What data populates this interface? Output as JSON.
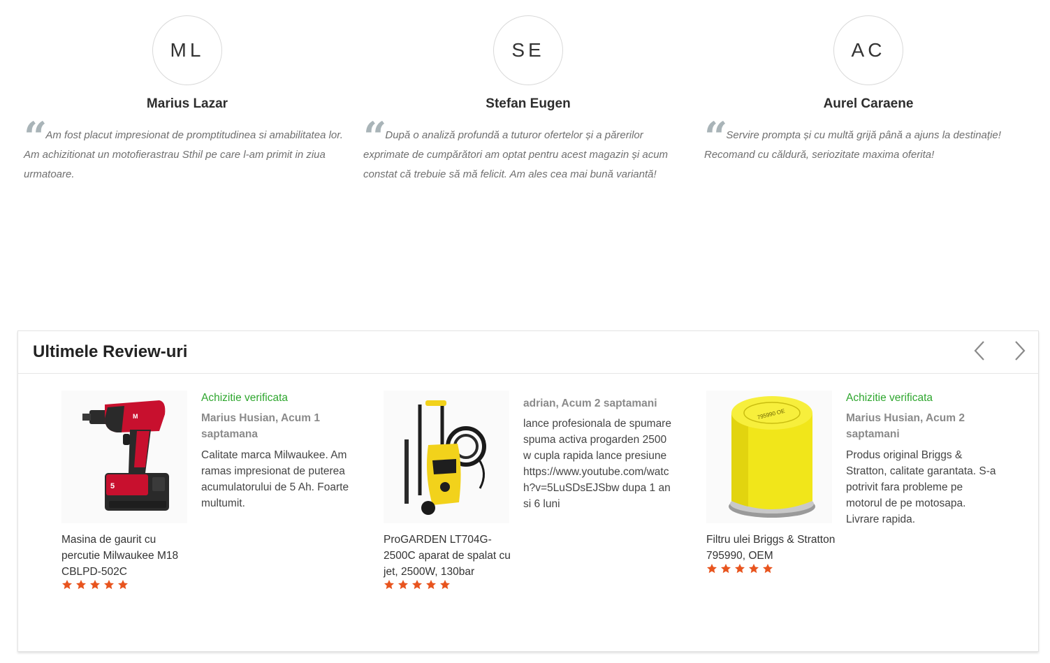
{
  "testimonials": [
    {
      "initials": "ML",
      "name": "Marius Lazar",
      "text": "Am fost placut impresionat de promptitudinea si amabilitatea lor. Am achizitionat un motofierastrau Sthil pe care l-am primit in ziua urmatoare."
    },
    {
      "initials": "SE",
      "name": "Stefan Eugen",
      "text": "După o analiză profundă a tuturor ofertelor și a părerilor exprimate de cumpărători am optat pentru acest magazin și acum constat că trebuie să mă felicit. Am ales cea mai bună variantă!"
    },
    {
      "initials": "AC",
      "name": "Aurel Caraene",
      "text": "Servire prompta și cu multă grijă până a ajuns la destinație! Recomand cu căldură, seriozitate maxima oferita!"
    }
  ],
  "reviews_panel": {
    "title": "Ultimele Review-uri",
    "prev_icon": "chevron-left-icon",
    "next_icon": "chevron-right-icon",
    "star_color": "#e8541e",
    "verified_color": "#2ea62e",
    "items": [
      {
        "product": "Masina de gaurit cu percutie Milwaukee M18 CBLPD-502C",
        "image_icon": "drill-image",
        "rating": 5,
        "verified": "Achizitie verificata",
        "reviewer": "Marius Husian, Acum 1 saptamana",
        "text": "Calitate marca Milwaukee. Am ramas impresionat de puterea acumulatorului de 5 Ah. Foarte multumit."
      },
      {
        "product": "ProGARDEN LT704G-2500C aparat de spalat cu jet, 2500W, 130bar",
        "image_icon": "pressure-washer-image",
        "rating": 5,
        "verified": "",
        "reviewer": "adrian, Acum 2 saptamani",
        "text": "lance profesionala de spumare spuma activa progarden 2500w cupla rapida lance presiune https://www.youtube.com/watch?v=5LuSDsEJSbw dupa 1 an si 6 luni"
      },
      {
        "product": "Filtru ulei Briggs & Stratton 795990, OEM",
        "image_icon": "oil-filter-image",
        "rating": 5,
        "verified": "Achizitie verificata",
        "reviewer": "Marius Husian, Acum 2 saptamani",
        "text": "Produs original Briggs & Stratton, calitate garantata. S-a potrivit fara probleme pe motorul de pe motosapa. Livrare rapida."
      }
    ]
  }
}
